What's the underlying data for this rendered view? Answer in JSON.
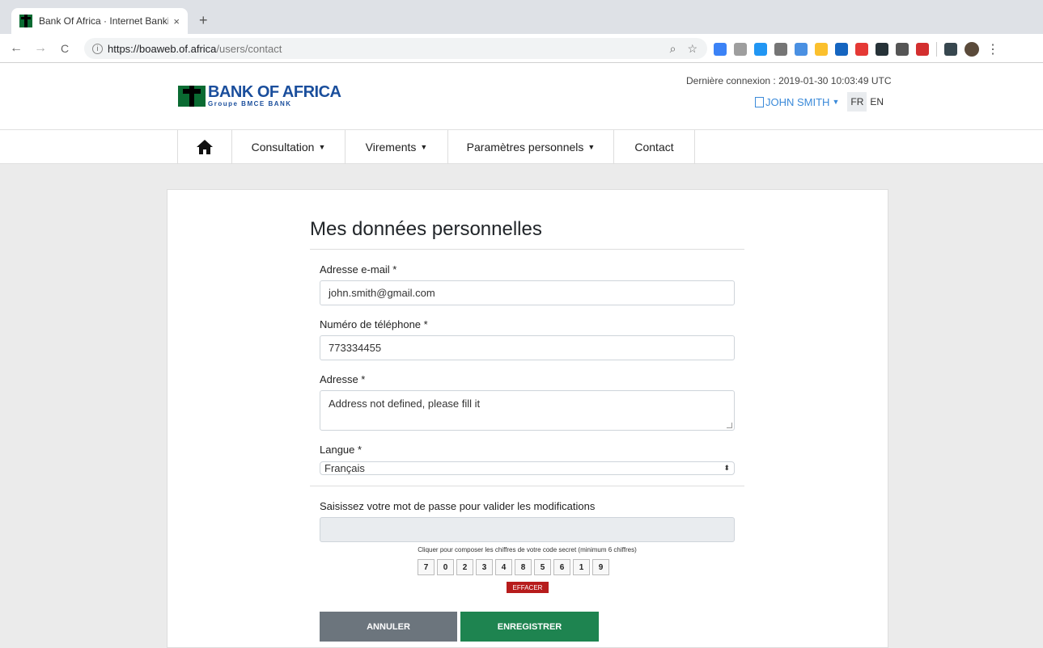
{
  "browser": {
    "tab_title": "Bank Of Africa · Internet Bankir",
    "tab_close": "×",
    "new_tab": "+",
    "url_host": "https://boaweb.of.africa",
    "url_path": "/users/contact",
    "back": "←",
    "forward": "→",
    "reload": "C",
    "zoom_icon": "⌕",
    "star_icon": "☆",
    "menu": "⋮",
    "extension_colors": [
      "#3b82f6",
      "#9e9e9e",
      "#2196f3",
      "#757575",
      "#4a90e2",
      "#fbc02d",
      "#1565c0",
      "#e53935",
      "#263238",
      "#555555",
      "#d32f2f",
      "#37474f"
    ]
  },
  "header": {
    "brand_name": "BANK OF AFRICA",
    "brand_sub": "Groupe BMCE BANK",
    "last_login": "Dernière connexion : 2019-01-30 10:03:49 UTC",
    "user_name": "JOHN SMITH",
    "lang_fr": "FR",
    "lang_en": "EN"
  },
  "nav": {
    "home_icon": "home-icon",
    "items": [
      {
        "label": "Consultation"
      },
      {
        "label": "Virements"
      },
      {
        "label": "Paramètres personnels"
      },
      {
        "label": "Contact"
      }
    ]
  },
  "form": {
    "title": "Mes données personnelles",
    "email_label": "Adresse e-mail *",
    "email_value": "john.smith@gmail.com",
    "phone_label": "Numéro de téléphone *",
    "phone_value": "773334455",
    "address_label": "Adresse *",
    "address_value": "Address not defined, please fill it",
    "language_label": "Langue *",
    "language_value": "Français",
    "password_label": "Saisissez votre mot de passe pour valider les modifications",
    "password_value": "",
    "pin_hint": "Cliquer pour composer les chiffres de votre code secret (minimum 6 chiffres)",
    "keypad": [
      "7",
      "0",
      "2",
      "3",
      "4",
      "8",
      "5",
      "6",
      "1",
      "9"
    ],
    "clear_label": "EFFACER",
    "cancel_label": "ANNULER",
    "save_label": "ENREGISTRER"
  },
  "colors": {
    "brand_blue": "#1a4e9c",
    "brand_green": "#0a6b32",
    "save_green": "#1e8450",
    "cancel_gray": "#6c757d",
    "clear_red": "#b71c1c",
    "link_blue": "#3b8ad9"
  }
}
